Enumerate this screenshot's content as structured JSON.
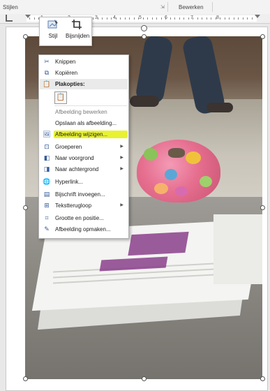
{
  "ribbon": {
    "group_styles": "Stijlen",
    "group_edit": "Bewerken"
  },
  "ruler": {
    "numbers": [
      "1",
      "2",
      "3",
      "4",
      "5",
      "6",
      "7",
      "8"
    ]
  },
  "mini_toolbar": {
    "style_label": "Stijl",
    "crop_label": "Bijsnijden",
    "style_icon": "picture-style-icon",
    "crop_icon": "crop-icon"
  },
  "context_menu": {
    "items": [
      {
        "label": "Knippen",
        "icon": "scissors-icon"
      },
      {
        "label": "Kopiëren",
        "icon": "copy-icon"
      },
      {
        "label": "Plakopties:",
        "icon": "clipboard-icon"
      },
      {
        "label": "Afbeelding bewerken",
        "icon": ""
      },
      {
        "label": "Opslaan als afbeelding...",
        "icon": ""
      },
      {
        "label": "Afbeelding wijzigen...",
        "icon": "change-picture-icon"
      },
      {
        "label": "Groeperen",
        "icon": "group-icon"
      },
      {
        "label": "Naar voorgrond",
        "icon": "bring-forward-icon"
      },
      {
        "label": "Naar achtergrond",
        "icon": "send-backward-icon"
      },
      {
        "label": "Hyperlink...",
        "icon": "hyperlink-icon"
      },
      {
        "label": "Bijschrift invoegen...",
        "icon": "caption-icon"
      },
      {
        "label": "Tekstterugloop",
        "icon": "wrap-text-icon"
      },
      {
        "label": "Grootte en positie...",
        "icon": "size-position-icon"
      },
      {
        "label": "Afbeelding opmaken...",
        "icon": "format-picture-icon"
      }
    ],
    "highlight_color": "#e6f11a"
  },
  "colors": {
    "menu_icon": "#355c9a",
    "stamp": "#8a3f8c"
  }
}
